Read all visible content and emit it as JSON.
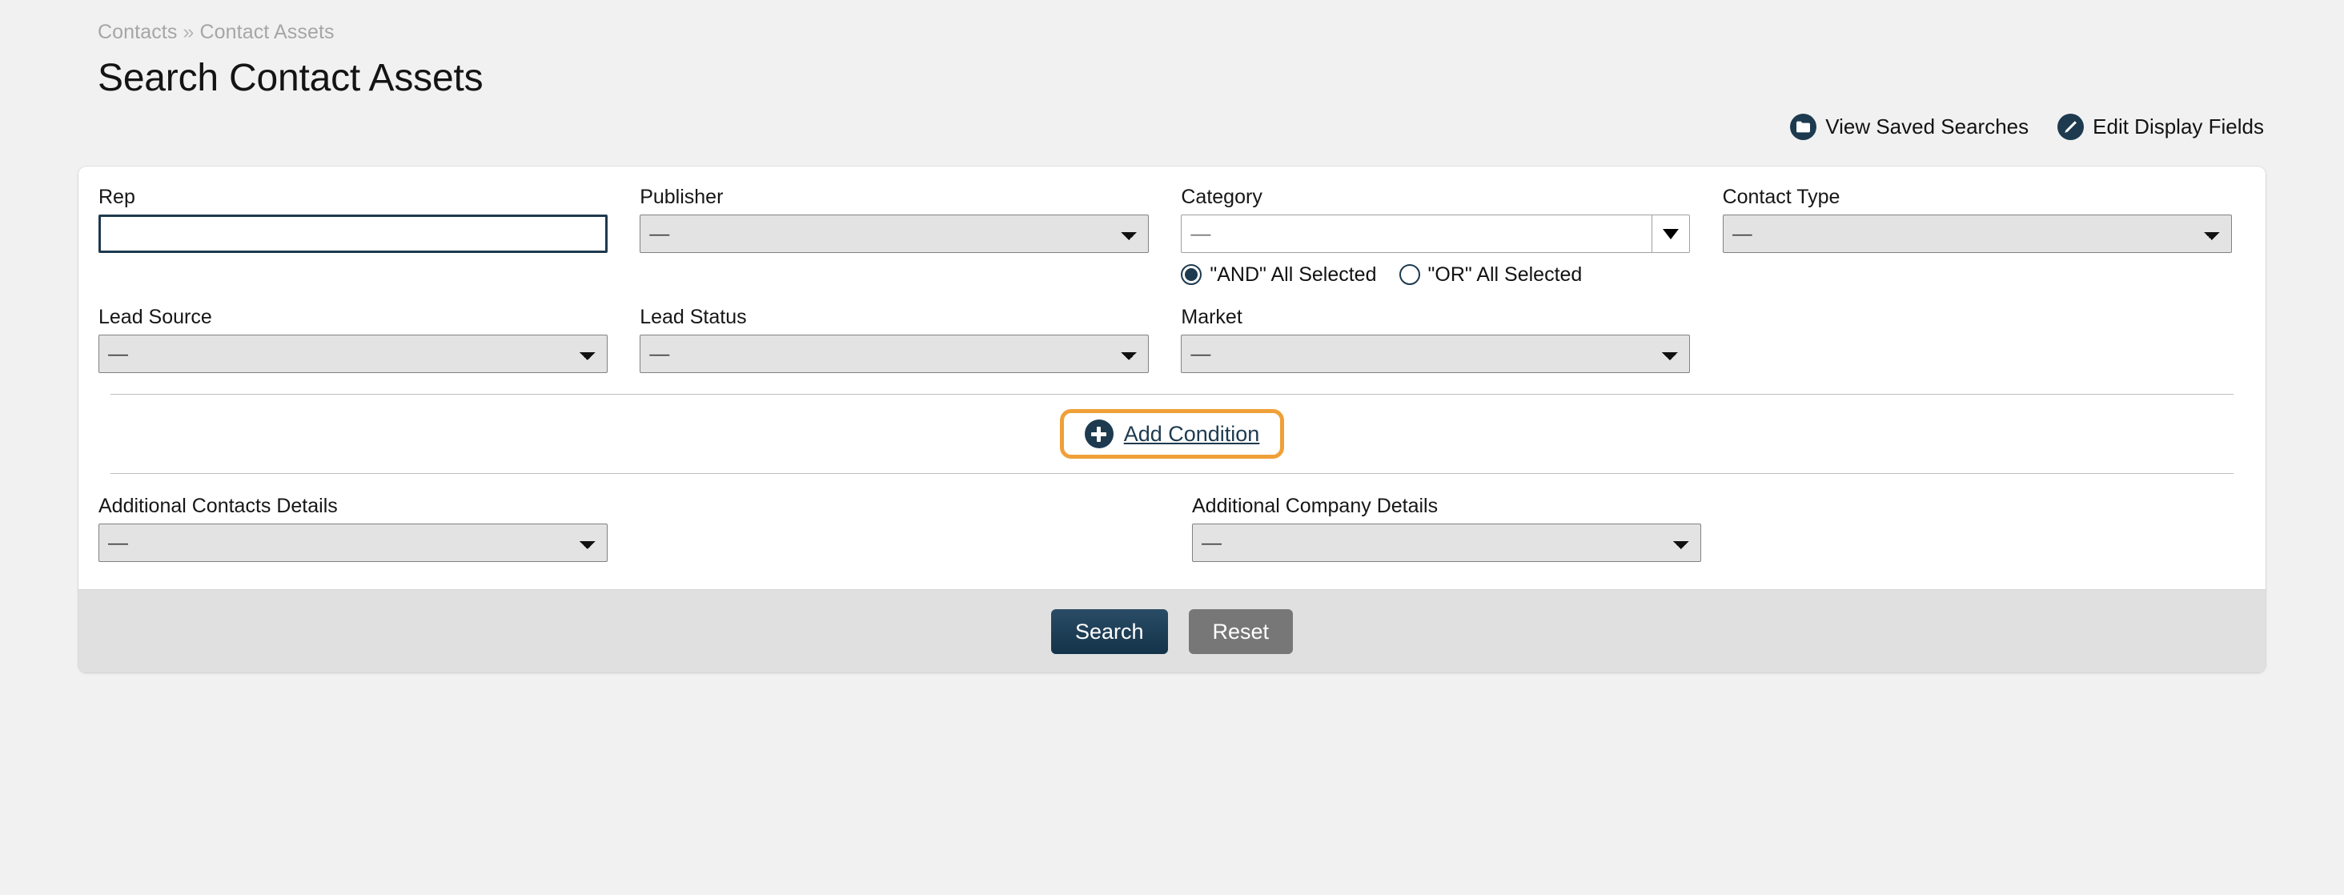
{
  "breadcrumb": {
    "items": [
      "Contacts",
      "Contact Assets"
    ],
    "separator": "»"
  },
  "page_title": "Search Contact Assets",
  "actions": [
    {
      "label": "View Saved Searches",
      "icon": "folder-icon"
    },
    {
      "label": "Edit Display Fields",
      "icon": "pencil-icon"
    }
  ],
  "form": {
    "row1": {
      "rep": {
        "label": "Rep",
        "value": "",
        "placeholder": "",
        "focused": true
      },
      "publisher": {
        "label": "Publisher",
        "value": "—"
      },
      "category": {
        "label": "Category",
        "value": "—",
        "dropdown_icon": "caret-down-icon",
        "radios": [
          {
            "label": "\"AND\" All Selected",
            "checked": true
          },
          {
            "label": "\"OR\" All Selected",
            "checked": false
          }
        ]
      },
      "contact_type": {
        "label": "Contact Type",
        "value": "—"
      }
    },
    "row2": {
      "lead_source": {
        "label": "Lead Source",
        "value": "—"
      },
      "lead_status": {
        "label": "Lead Status",
        "value": "—"
      },
      "market": {
        "label": "Market",
        "value": "—"
      }
    },
    "add_condition": {
      "label": "Add Condition",
      "icon": "plus-circle-icon",
      "highlighted": true,
      "highlight_color": "#f0a038"
    },
    "row3": {
      "additional_contacts_details": {
        "label": "Additional Contacts Details",
        "value": "—"
      },
      "additional_company_details": {
        "label": "Additional Company Details",
        "value": "—"
      }
    }
  },
  "footer": {
    "search_label": "Search",
    "reset_label": "Reset"
  },
  "colors": {
    "accent_navy": "#1d3a4f",
    "highlight_orange": "#f0a038",
    "page_background": "#f1f1f1",
    "footer_background": "#e0e0e0",
    "reset_gray": "#777777"
  }
}
